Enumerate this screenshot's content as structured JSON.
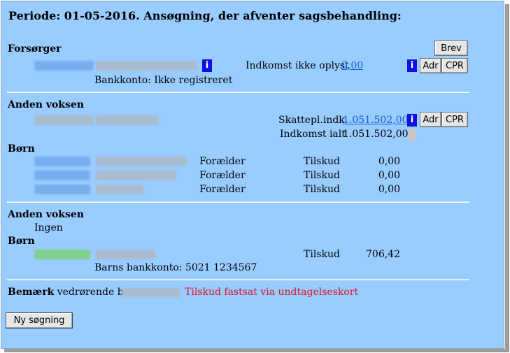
{
  "title": "Periode: 01-05-2016. Ansøgning, der afventer sagsbehandling:",
  "forsorger": {
    "heading": "Forsørger",
    "income_label": "Indkomst ikke oplyst",
    "income_value": "0,00",
    "bank_account": "Bankkonto: Ikke registreret",
    "brev_label": "Brev",
    "adr_label": "Adr",
    "cpr_label": "CPR",
    "info_icon": "i"
  },
  "anden_voksen_1": {
    "heading": "Anden voksen",
    "taxable_label": "Skattepl.indk.",
    "taxable_value": "1.051.502,00",
    "total_label": "Indkomst ialt",
    "total_value": "1.051.502,00",
    "adr_label": "Adr",
    "cpr_label": "CPR",
    "info_icon": "i"
  },
  "born_1": {
    "heading": "Børn",
    "rows": [
      {
        "role": "Forælder",
        "tilskud_label": "Tilskud",
        "amount": "0,00"
      },
      {
        "role": "Forælder",
        "tilskud_label": "Tilskud",
        "amount": "0,00"
      },
      {
        "role": "Forælder",
        "tilskud_label": "Tilskud",
        "amount": "0,00"
      }
    ]
  },
  "anden_voksen_2": {
    "heading": "Anden voksen",
    "value": "Ingen"
  },
  "born_2": {
    "heading": "Børn",
    "tilskud_label": "Tilskud",
    "amount": "706,42",
    "bank_account": "Barns bankkonto: 5021 1234567"
  },
  "remark": {
    "label_bold": "Bemærk",
    "label_rest": " vedrørende barn",
    "note": "Tilskud fastsat via undtagelseskort"
  },
  "new_search_label": "Ny søgning",
  "colors": {
    "panel": "#99ccff",
    "link": "#1a5bd6",
    "info_icon": "#1010e0",
    "remark_note": "#e01020"
  }
}
